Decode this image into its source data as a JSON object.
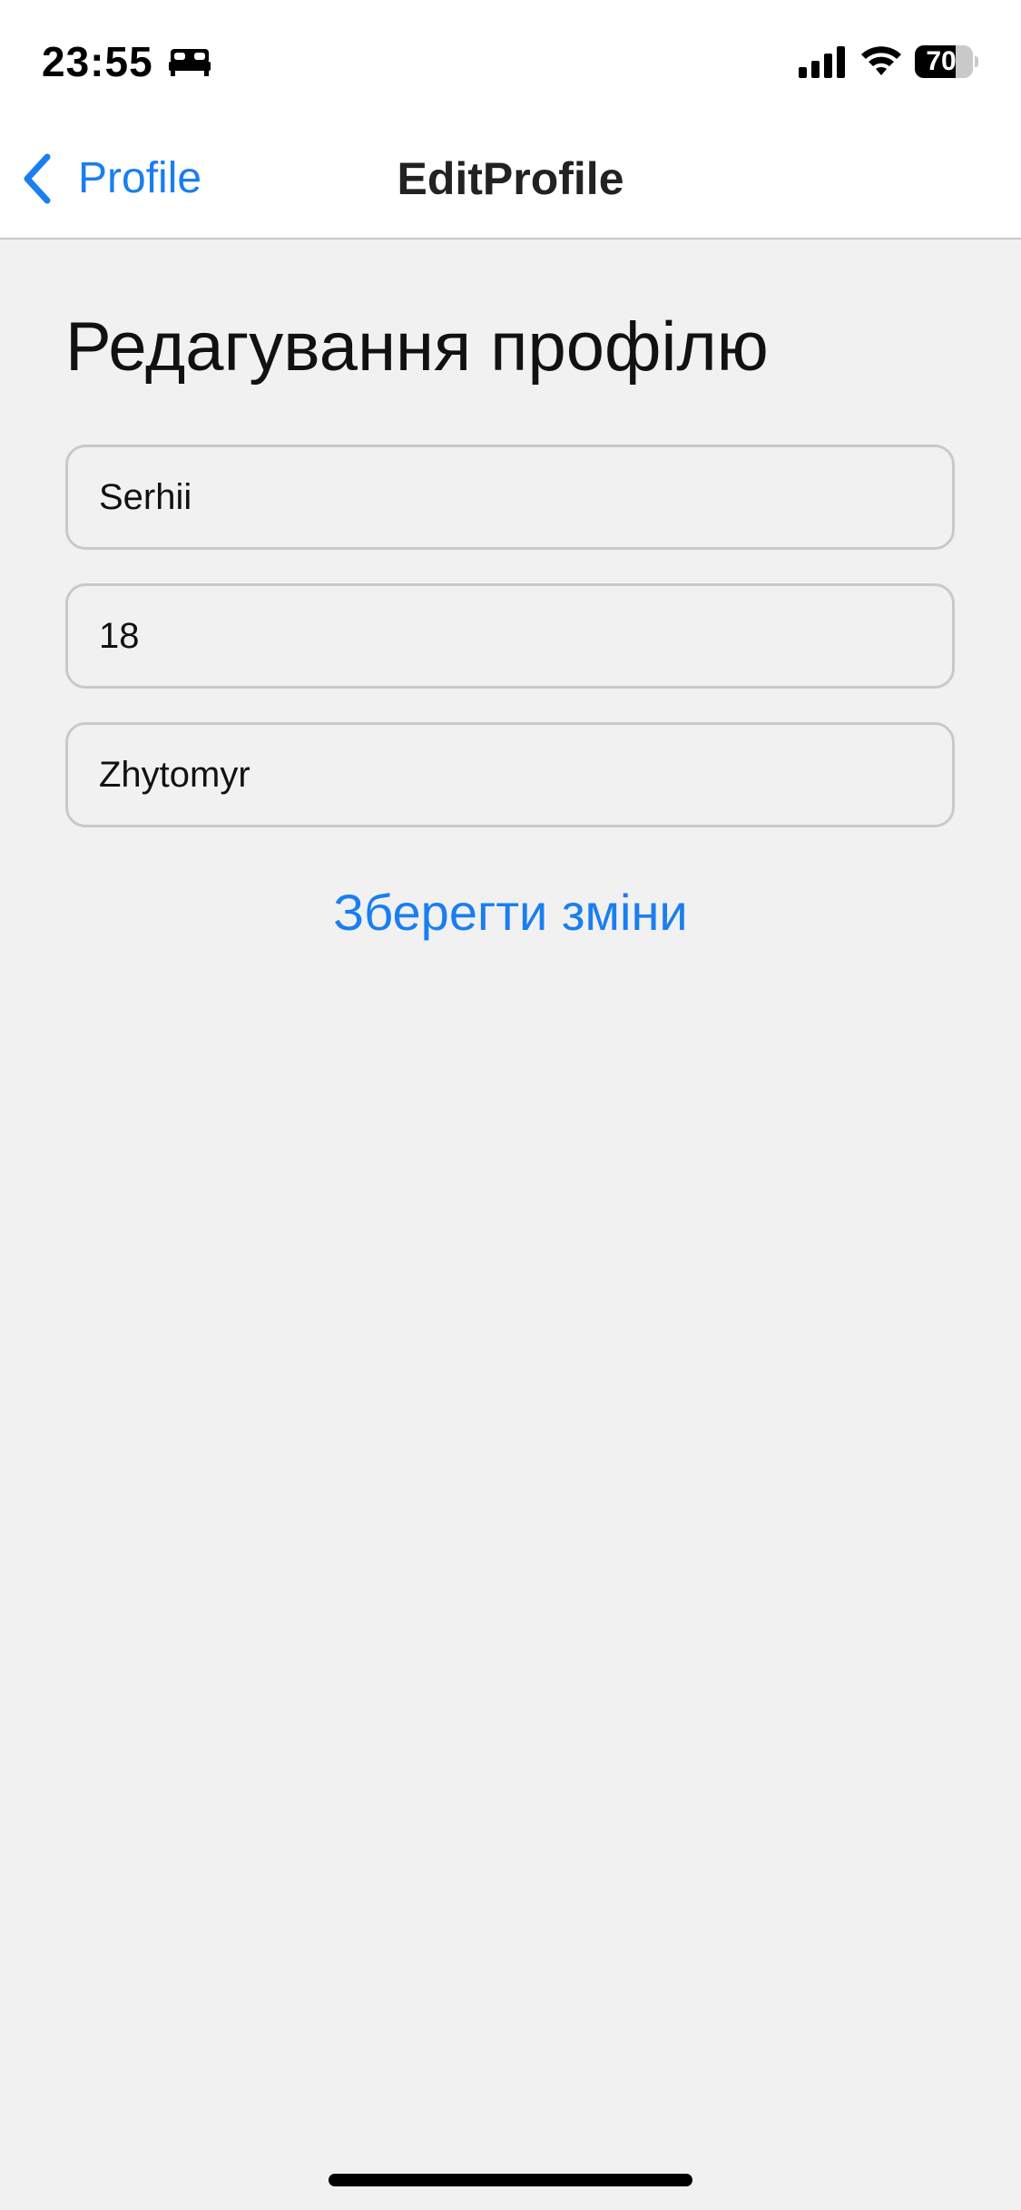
{
  "status_bar": {
    "time": "23:55",
    "battery_percent": "70",
    "battery_level": 0.7,
    "icons": [
      "sleep-icon",
      "signal-icon",
      "wifi-icon",
      "battery-icon"
    ]
  },
  "nav": {
    "back_label": "Profile",
    "title": "EditProfile",
    "accent_color": "#1a7ef0"
  },
  "form": {
    "heading": "Редагування профілю",
    "fields": [
      {
        "name": "name",
        "value": "Serhii"
      },
      {
        "name": "age",
        "value": "18"
      },
      {
        "name": "city",
        "value": "Zhytomyr"
      }
    ],
    "save_label": "Зберегти зміни"
  }
}
